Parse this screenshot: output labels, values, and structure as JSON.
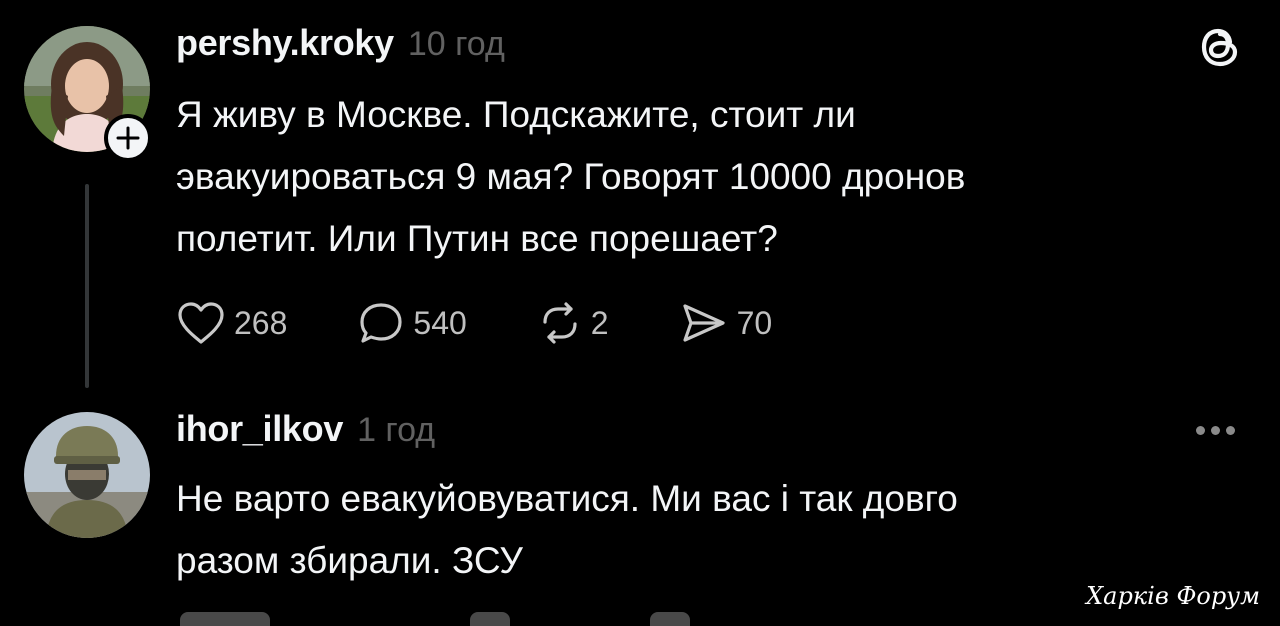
{
  "posts": [
    {
      "username": "pershy.kroky",
      "time": "10 год",
      "lines": [
        "Я живу в Москве. Подскажите, стоит ли",
        "эвакуироваться 9 мая? Говорят 10000 дронов",
        "полетит. Или Путин все порешает?"
      ],
      "likes": "268",
      "replies": "540",
      "reposts": "2",
      "shares": "70"
    },
    {
      "username": "ihor_ilkov",
      "time": "1 год",
      "lines": [
        "Не варто евакуйовуватися. Ми вас і так довго",
        "разом збирали. ЗСУ"
      ]
    }
  ],
  "watermark": "Харків Форум",
  "colors": {
    "background": "#000000",
    "text": "#f3f5f7",
    "muted": "#616161"
  },
  "icons": {
    "like": "heart-icon",
    "reply": "comment-icon",
    "repost": "repost-icon",
    "share": "share-icon",
    "logo": "threads-logo-icon",
    "more": "more-dots-icon",
    "follow": "plus-icon"
  }
}
